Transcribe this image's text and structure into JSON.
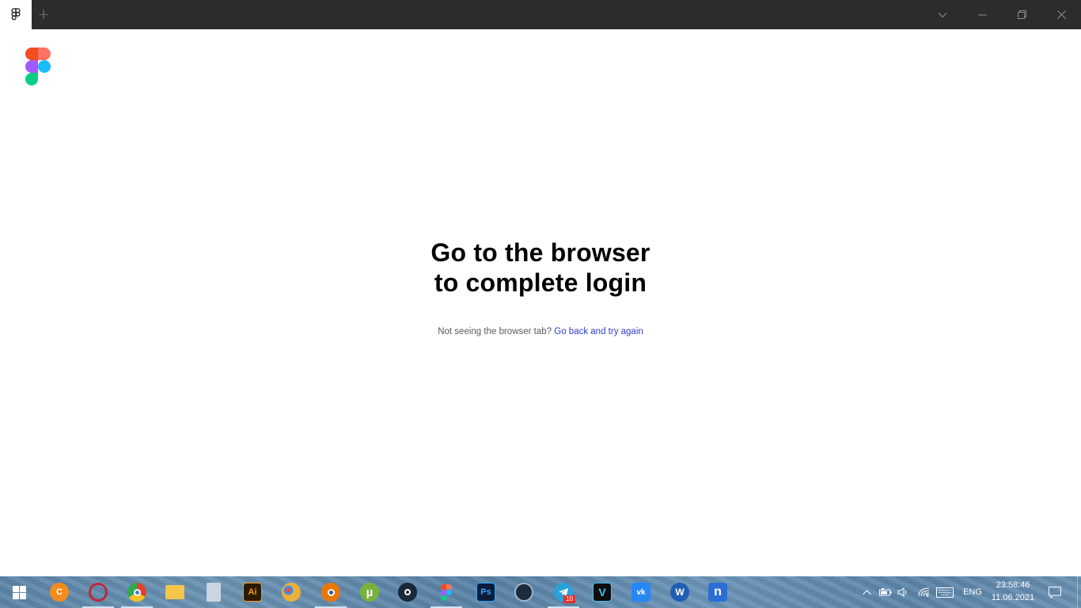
{
  "window": {
    "app_icon": "figma-icon",
    "new_tab_label": "+",
    "controls": [
      "chevron-down-icon",
      "minimize-icon",
      "restore-icon",
      "close-icon"
    ]
  },
  "main": {
    "logo": "figma-logo",
    "heading_line1": "Go to the browser",
    "heading_line2": "to complete login",
    "hint_text": "Not seeing the browser tab?",
    "hint_link": "Go back and try again"
  },
  "taskbar": {
    "start_icon": "windows-start-icon",
    "apps": [
      {
        "name": "ccleaner",
        "label": "C",
        "color": "#f28c1e"
      },
      {
        "name": "opera",
        "label": "",
        "color": "#c0273c"
      },
      {
        "name": "chrome",
        "label": "",
        "color": "#e0412e"
      },
      {
        "name": "file-explorer",
        "label": "",
        "color": "#f3c54a"
      },
      {
        "name": "calculator",
        "label": "",
        "color": "#b9c6d2"
      },
      {
        "name": "illustrator",
        "label": "Ai",
        "color": "#2b1b04"
      },
      {
        "name": "paint",
        "label": "",
        "color": "#e9b03b"
      },
      {
        "name": "blender",
        "label": "",
        "color": "#ea7600"
      },
      {
        "name": "utorrent",
        "label": "µ",
        "color": "#77b33b"
      },
      {
        "name": "steam",
        "label": "",
        "color": "#1b2838"
      },
      {
        "name": "figma",
        "label": "",
        "color": "#a259ff"
      },
      {
        "name": "photoshop",
        "label": "Ps",
        "color": "#0b1b3a"
      },
      {
        "name": "cinema4d",
        "label": "",
        "color": "#1e2b3c"
      },
      {
        "name": "telegram",
        "label": "",
        "color": "#2aa1db"
      },
      {
        "name": "vegas",
        "label": "V",
        "color": "#0d0d0d"
      },
      {
        "name": "vk",
        "label": "vk",
        "color": "#2787f5"
      },
      {
        "name": "wrike",
        "label": "W",
        "color": "#1e5fb4"
      },
      {
        "name": "n-app",
        "label": "n",
        "color": "#2b6fd6"
      }
    ],
    "telegram_badge": "10",
    "language": "ENG",
    "time": "23:58:46",
    "date": "11.06.2021"
  }
}
